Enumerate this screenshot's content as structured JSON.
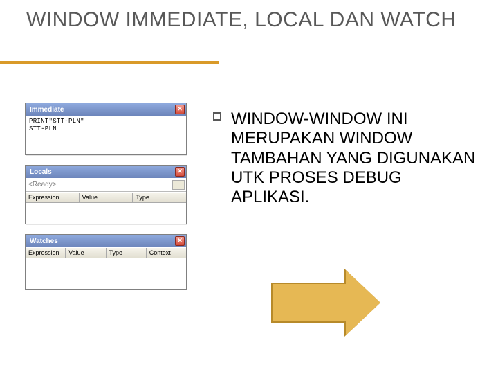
{
  "title": "WINDOW IMMEDIATE, LOCAL DAN WATCH",
  "paragraph": "WINDOW-WINDOW INI MERUPAKAN WINDOW TAMBAHAN YANG DIGUNAKAN UTK PROSES DEBUG APLIKASI.",
  "panels": {
    "immediate": {
      "title": "Immediate",
      "line1": "PRINT\"STT-PLN\"",
      "line2": "STT-PLN"
    },
    "locals": {
      "title": "Locals",
      "placeholder": "<Ready>",
      "cols": {
        "c1": "Expression",
        "c2": "Value",
        "c3": "Type"
      }
    },
    "watches": {
      "title": "Watches",
      "cols": {
        "c1": "Expression",
        "c2": "Value",
        "c3": "Type",
        "c4": "Context"
      }
    }
  },
  "close_glyph": "✕",
  "dots": "..."
}
